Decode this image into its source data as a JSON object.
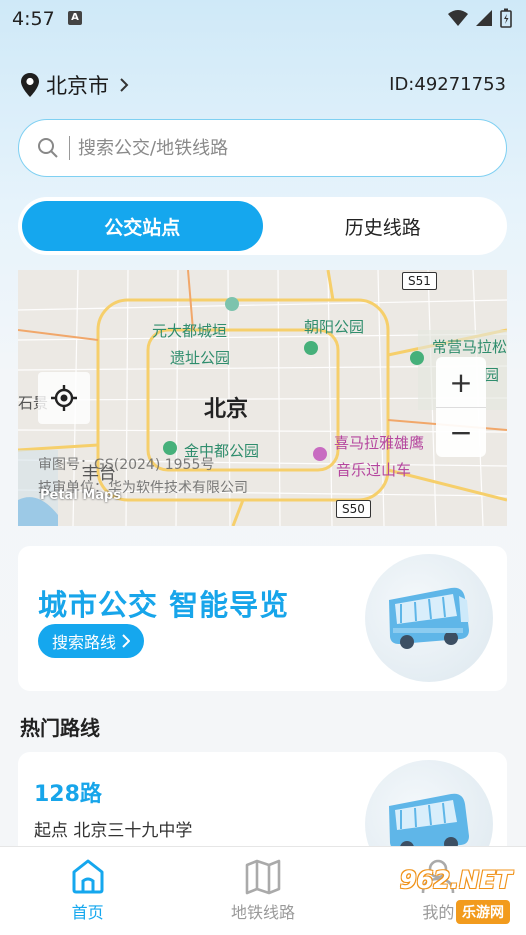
{
  "status_bar": {
    "time": "4:57",
    "notif_icon": "A"
  },
  "header": {
    "city": "北京市",
    "user_id": "ID:49271753"
  },
  "search": {
    "placeholder": "搜索公交/地铁线路"
  },
  "tabs": [
    {
      "label": "公交站点",
      "active": true
    },
    {
      "label": "历史线路",
      "active": false
    }
  ],
  "map": {
    "city_label": "北京",
    "places": [
      "元大都城垣",
      "遗址公园",
      "朝阳公园",
      "常营马拉松",
      "园",
      "金中都公园",
      "喜马拉雅雄鹰",
      "音乐过山车",
      "丰台",
      "石景"
    ],
    "roads": [
      "S51",
      "S50"
    ],
    "watermark_1": "审图号：GS(2024) 1955号",
    "watermark_2": "技审单位：华为软件技术有限公司",
    "provider": "Petal Maps",
    "zoom_in": "+",
    "zoom_out": "−"
  },
  "promo": {
    "title": "城市公交 智能导览",
    "button": "搜索路线"
  },
  "hot_routes": {
    "section_title": "热门路线",
    "items": [
      {
        "name": "128路",
        "start": "起点 北京三十九中学"
      }
    ]
  },
  "bottom_nav": [
    {
      "label": "首页",
      "icon": "home-icon",
      "active": true
    },
    {
      "label": "地铁线路",
      "icon": "map-icon",
      "active": false
    },
    {
      "label": "我的",
      "icon": "person-icon",
      "active": false
    }
  ],
  "brand": {
    "main": "962.NET",
    "sub": "乐游网"
  },
  "colors": {
    "accent": "#15a7ee",
    "accent_text": "#17a5ea",
    "park_green": "#2f8d6d"
  }
}
